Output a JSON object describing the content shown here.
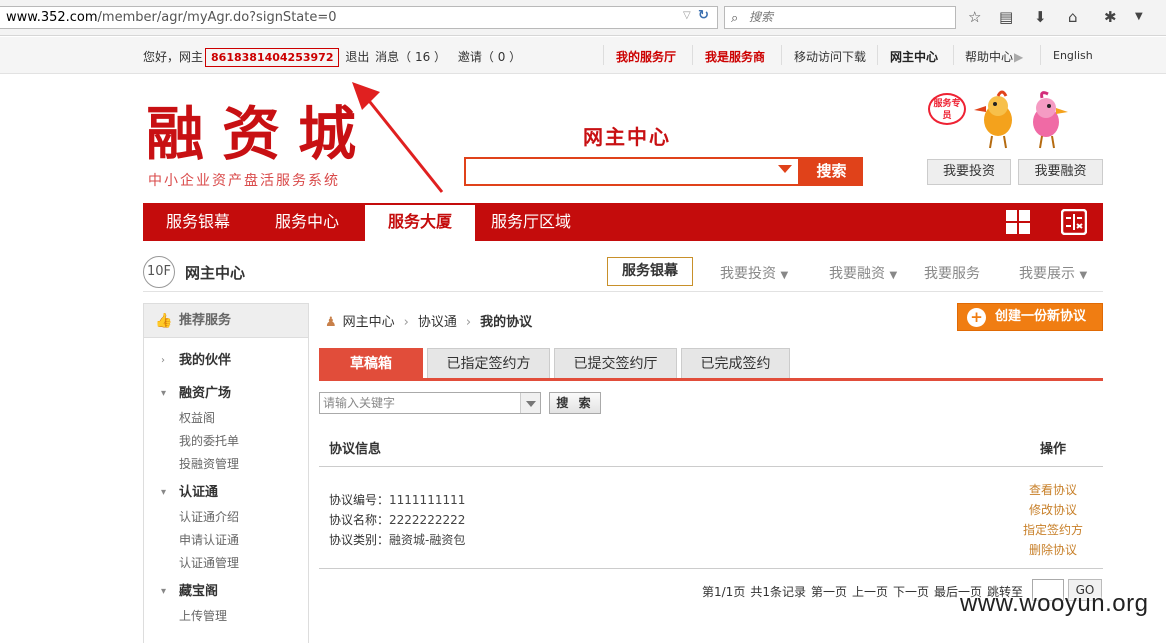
{
  "browser": {
    "url_domain": "www.352.com",
    "url_path": "/member/agr/myAgr.do?signState=0",
    "search_placeholder": "搜索"
  },
  "topbar": {
    "greeting": "您好，网主",
    "user_id": "8618381404253972",
    "logout": "退出",
    "messages": "消息（ 16 ）",
    "invites": "邀请（ 0 ）",
    "links": [
      "我的服务厅",
      "我是服务商",
      "移动访问下载",
      "网主中心",
      "帮助中心",
      "English"
    ]
  },
  "header": {
    "logo": "融资城",
    "logo_sub": "中小企业资产盘活服务系统",
    "center_title": "网主中心",
    "search_button": "搜索",
    "badge": "服务专员",
    "invest_button": "我要投资",
    "finance_button": "我要融资"
  },
  "nav": {
    "items": [
      "服务银幕",
      "服务中心",
      "服务大厦",
      "服务厅区域"
    ],
    "active_index": 2
  },
  "floor": {
    "label": "10F",
    "title": "网主中心",
    "links": [
      "服务银幕",
      "我要投资",
      "我要融资",
      "我要服务",
      "我要展示"
    ]
  },
  "sidebar": {
    "header": "推荐服务",
    "groups": [
      {
        "label": "我的伙伴",
        "items": []
      },
      {
        "label": "融资广场",
        "items": [
          "权益阁",
          "我的委托单",
          "投融资管理"
        ]
      },
      {
        "label": "认证通",
        "items": [
          "认证通介绍",
          "申请认证通",
          "认证通管理"
        ]
      },
      {
        "label": "藏宝阁",
        "items": [
          "上传管理"
        ]
      }
    ]
  },
  "breadcrumb": {
    "items": [
      "网主中心",
      "协议通",
      "我的协议"
    ]
  },
  "create_button": "创建一份新协议",
  "tabs": [
    "草稿箱",
    "已指定签约方",
    "已提交签约厅",
    "已完成签约"
  ],
  "search": {
    "placeholder": "请输入关键字",
    "button": "搜 索"
  },
  "table": {
    "header_info": "协议信息",
    "header_action": "操作",
    "row": {
      "number_label": "协议编号：",
      "number": "1111111111",
      "name_label": "协议名称：",
      "name": "2222222222",
      "type_label": "协议类别：",
      "type": "融资城-融资包",
      "actions": [
        "查看协议",
        "修改协议",
        "指定签约方",
        "删除协议"
      ]
    }
  },
  "pager": {
    "info": "第1/1页",
    "total": "共1条记录",
    "first": "第一页",
    "prev": "上一页",
    "next": "下一页",
    "last": "最后一页",
    "jump": "跳转至",
    "go": "GO"
  },
  "watermark": "www.wooyun.org"
}
